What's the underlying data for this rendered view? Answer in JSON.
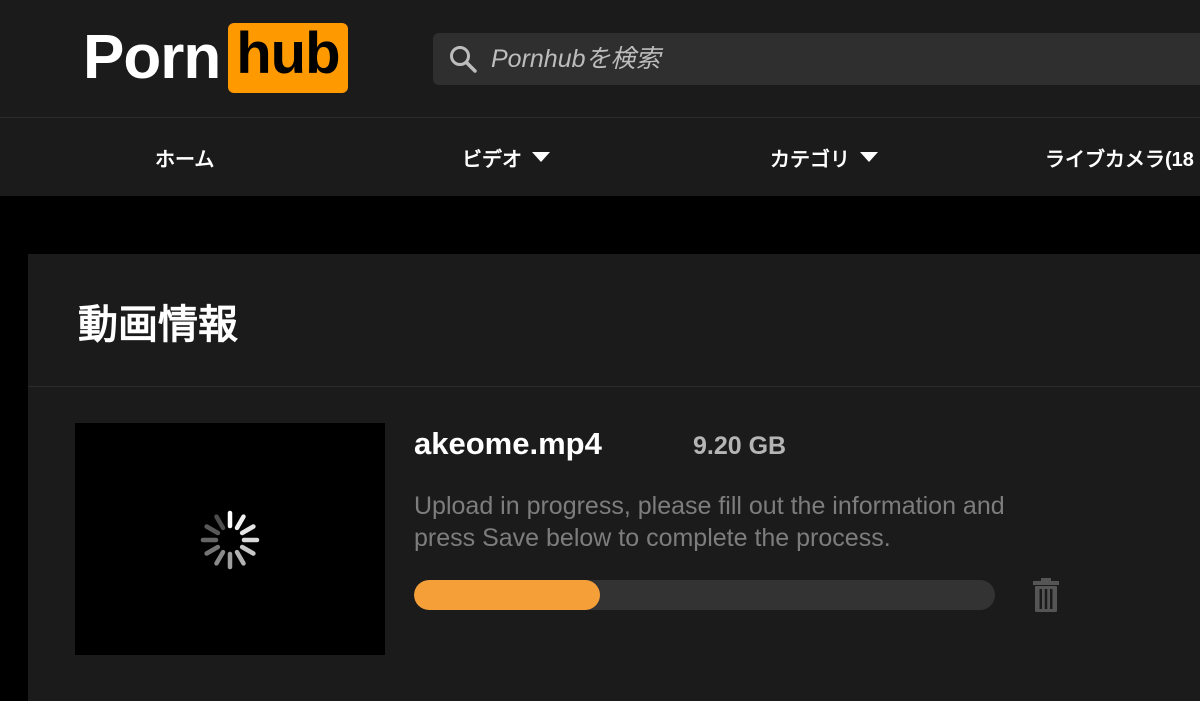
{
  "header": {
    "logo": {
      "left_text": "Porn",
      "right_text": "hub"
    },
    "search": {
      "placeholder": "Pornhubを検索",
      "icon": "search-icon"
    }
  },
  "nav": {
    "items": [
      {
        "label": "ホーム",
        "has_dropdown": false
      },
      {
        "label": "ビデオ",
        "has_dropdown": true
      },
      {
        "label": "カテゴリ",
        "has_dropdown": true
      },
      {
        "label": "ライブカメラ(18",
        "has_dropdown": false
      }
    ]
  },
  "upload_panel": {
    "title": "動画情報",
    "file": {
      "name": "akeome.mp4",
      "size": "9.20 GB",
      "status_message": "Upload in progress, please fill out the information and press Save below to complete the process.",
      "progress": 0.32
    },
    "thumbnail": {
      "icon": "loading-spinner-icon"
    },
    "delete": {
      "icon": "trash-icon"
    }
  },
  "colors": {
    "accent": "#ff9900",
    "progress_fill": "#f59f38",
    "background": "#000000",
    "surface": "#1b1b1b"
  }
}
